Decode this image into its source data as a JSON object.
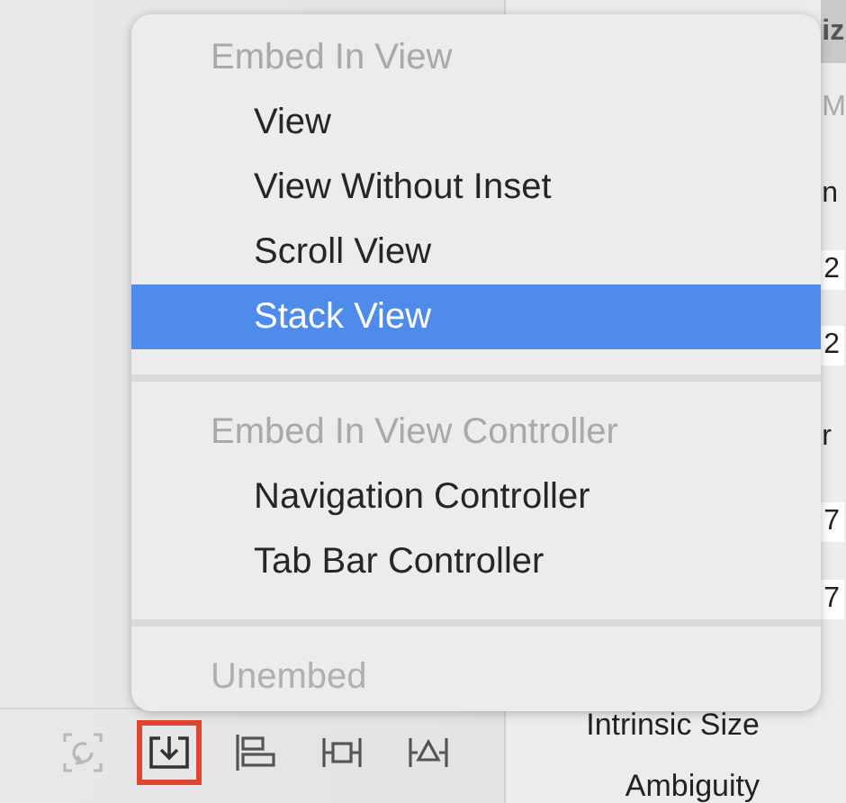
{
  "inspector": {
    "fragments": [
      {
        "text": "iz",
        "kind": "header"
      },
      {
        "text": "M",
        "kind": "hint"
      },
      {
        "text": "n",
        "kind": "label"
      },
      {
        "text": "2",
        "kind": "field"
      },
      {
        "text": "2",
        "kind": "field"
      },
      {
        "text": "r",
        "kind": "label"
      },
      {
        "text": "7",
        "kind": "field"
      },
      {
        "text": "7",
        "kind": "field"
      }
    ],
    "labels": [
      "Intrinsic Size",
      "Ambiguity"
    ]
  },
  "menu": {
    "sections": [
      {
        "header": "Embed In View",
        "items": [
          {
            "label": "View",
            "selected": false,
            "disabled": false
          },
          {
            "label": "View Without Inset",
            "selected": false,
            "disabled": false
          },
          {
            "label": "Scroll View",
            "selected": false,
            "disabled": false
          },
          {
            "label": "Stack View",
            "selected": true,
            "disabled": false
          }
        ]
      },
      {
        "header": "Embed In View Controller",
        "items": [
          {
            "label": "Navigation Controller",
            "selected": false,
            "disabled": false
          },
          {
            "label": "Tab Bar Controller",
            "selected": false,
            "disabled": false
          }
        ]
      },
      {
        "items": [
          {
            "label": "Unembed",
            "selected": false,
            "disabled": true
          }
        ]
      }
    ]
  },
  "toolbar": {
    "buttons": [
      {
        "kind": "update-frames",
        "disabled": true,
        "selected": false
      },
      {
        "kind": "embed",
        "disabled": false,
        "selected": true
      },
      {
        "kind": "align",
        "disabled": false,
        "selected": false
      },
      {
        "kind": "pin",
        "disabled": false,
        "selected": false
      },
      {
        "kind": "resolve",
        "disabled": false,
        "selected": false
      }
    ]
  }
}
